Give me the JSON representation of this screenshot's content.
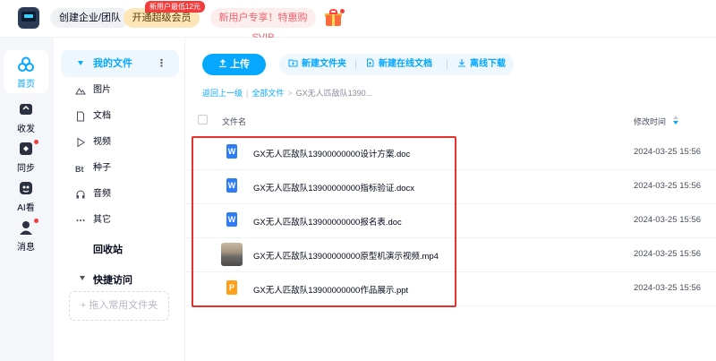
{
  "topbar": {
    "team_label": "创建企业/团队",
    "vip_label": "开通超级会员",
    "vip_badge": "新用户最低12元",
    "promo_label": "新用户专享！特惠购SVIP"
  },
  "rail": {
    "items": [
      {
        "label": "首页",
        "icon": "home-icon"
      },
      {
        "label": "收发",
        "icon": "transfer-icon"
      },
      {
        "label": "同步",
        "icon": "sync-icon"
      },
      {
        "label": "AI看",
        "icon": "ai-watch-icon"
      },
      {
        "label": "消息",
        "icon": "message-icon"
      }
    ]
  },
  "nav": {
    "my_files": "我的文件",
    "more": "⋮",
    "subs": [
      {
        "label": "图片",
        "icon": "image-icon"
      },
      {
        "label": "文档",
        "icon": "document-icon"
      },
      {
        "label": "视频",
        "icon": "video-icon"
      },
      {
        "label": "种子",
        "icon": "bt-icon"
      },
      {
        "label": "音频",
        "icon": "headphone-icon"
      },
      {
        "label": "其它",
        "icon": "more-dots-icon"
      }
    ],
    "trash": "回收站",
    "quick_access": "快捷访问",
    "drop_hint": "+ 拖入常用文件夹"
  },
  "toolbar": {
    "upload": "上传",
    "new_folder": "新建文件夹",
    "new_online_doc": "新建在线文档",
    "offline_download": "离线下载"
  },
  "breadcrumb": {
    "back": "返回上一级",
    "all_files": "全部文件",
    "current": "GX无人匹敌队1390..."
  },
  "table": {
    "col_name": "文件名",
    "col_time": "修改时间",
    "rows": [
      {
        "name": "GX无人匹敌队13900000000设计方案.doc",
        "time": "2024-03-25 15:56",
        "type": "word"
      },
      {
        "name": "GX无人匹敌队13900000000指标验证.docx",
        "time": "2024-03-25 15:56",
        "type": "word"
      },
      {
        "name": "GX无人匹敌队13900000000报名表.doc",
        "time": "2024-03-25 15:56",
        "type": "word"
      },
      {
        "name": "GX无人匹敌队13900000000原型机演示视频.mp4",
        "time": "2024-03-25 15:56",
        "type": "video"
      },
      {
        "name": "GX无人匹敌队13900000000作品展示.ppt",
        "time": "2024-03-25 15:56",
        "type": "ppt"
      }
    ]
  },
  "colors": {
    "accent": "#06a7ff",
    "word": "#2e7cf6",
    "ppt": "#ff9f1a",
    "highlight": "#e5322d"
  }
}
